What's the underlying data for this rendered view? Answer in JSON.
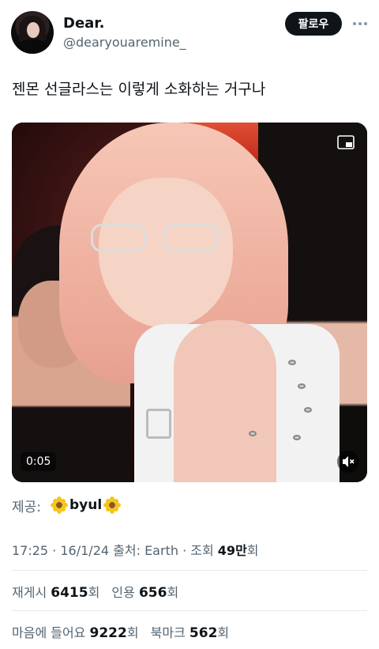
{
  "user": {
    "name": "Dear.",
    "handle": "@dearyouaremine_"
  },
  "follow_label": "팔로우",
  "tweet_text": "젠몬 선글라스는 이렇게 소화하는 거구나",
  "media": {
    "duration": "0:05",
    "type": "video"
  },
  "source": {
    "label": "제공:",
    "name": "byul",
    "icon": "sunflower-icon"
  },
  "meta": {
    "time": "17:25",
    "date": "16/1/24",
    "source_label": "출처: Earth",
    "views_label": "조회",
    "views": "49만",
    "views_suffix": "회"
  },
  "stats": {
    "retweets_label": "재게시",
    "retweets": "6415",
    "quotes_label": "인용",
    "quotes": "656",
    "likes_label": "마음에 들어요",
    "likes": "9222",
    "bookmarks_label": "북마크",
    "bookmarks": "562",
    "unit": "회"
  },
  "colors": {
    "primary_text": "#0f1419",
    "secondary_text": "#536471",
    "divider": "#e4e8eb",
    "follow_bg": "#0f1419"
  }
}
